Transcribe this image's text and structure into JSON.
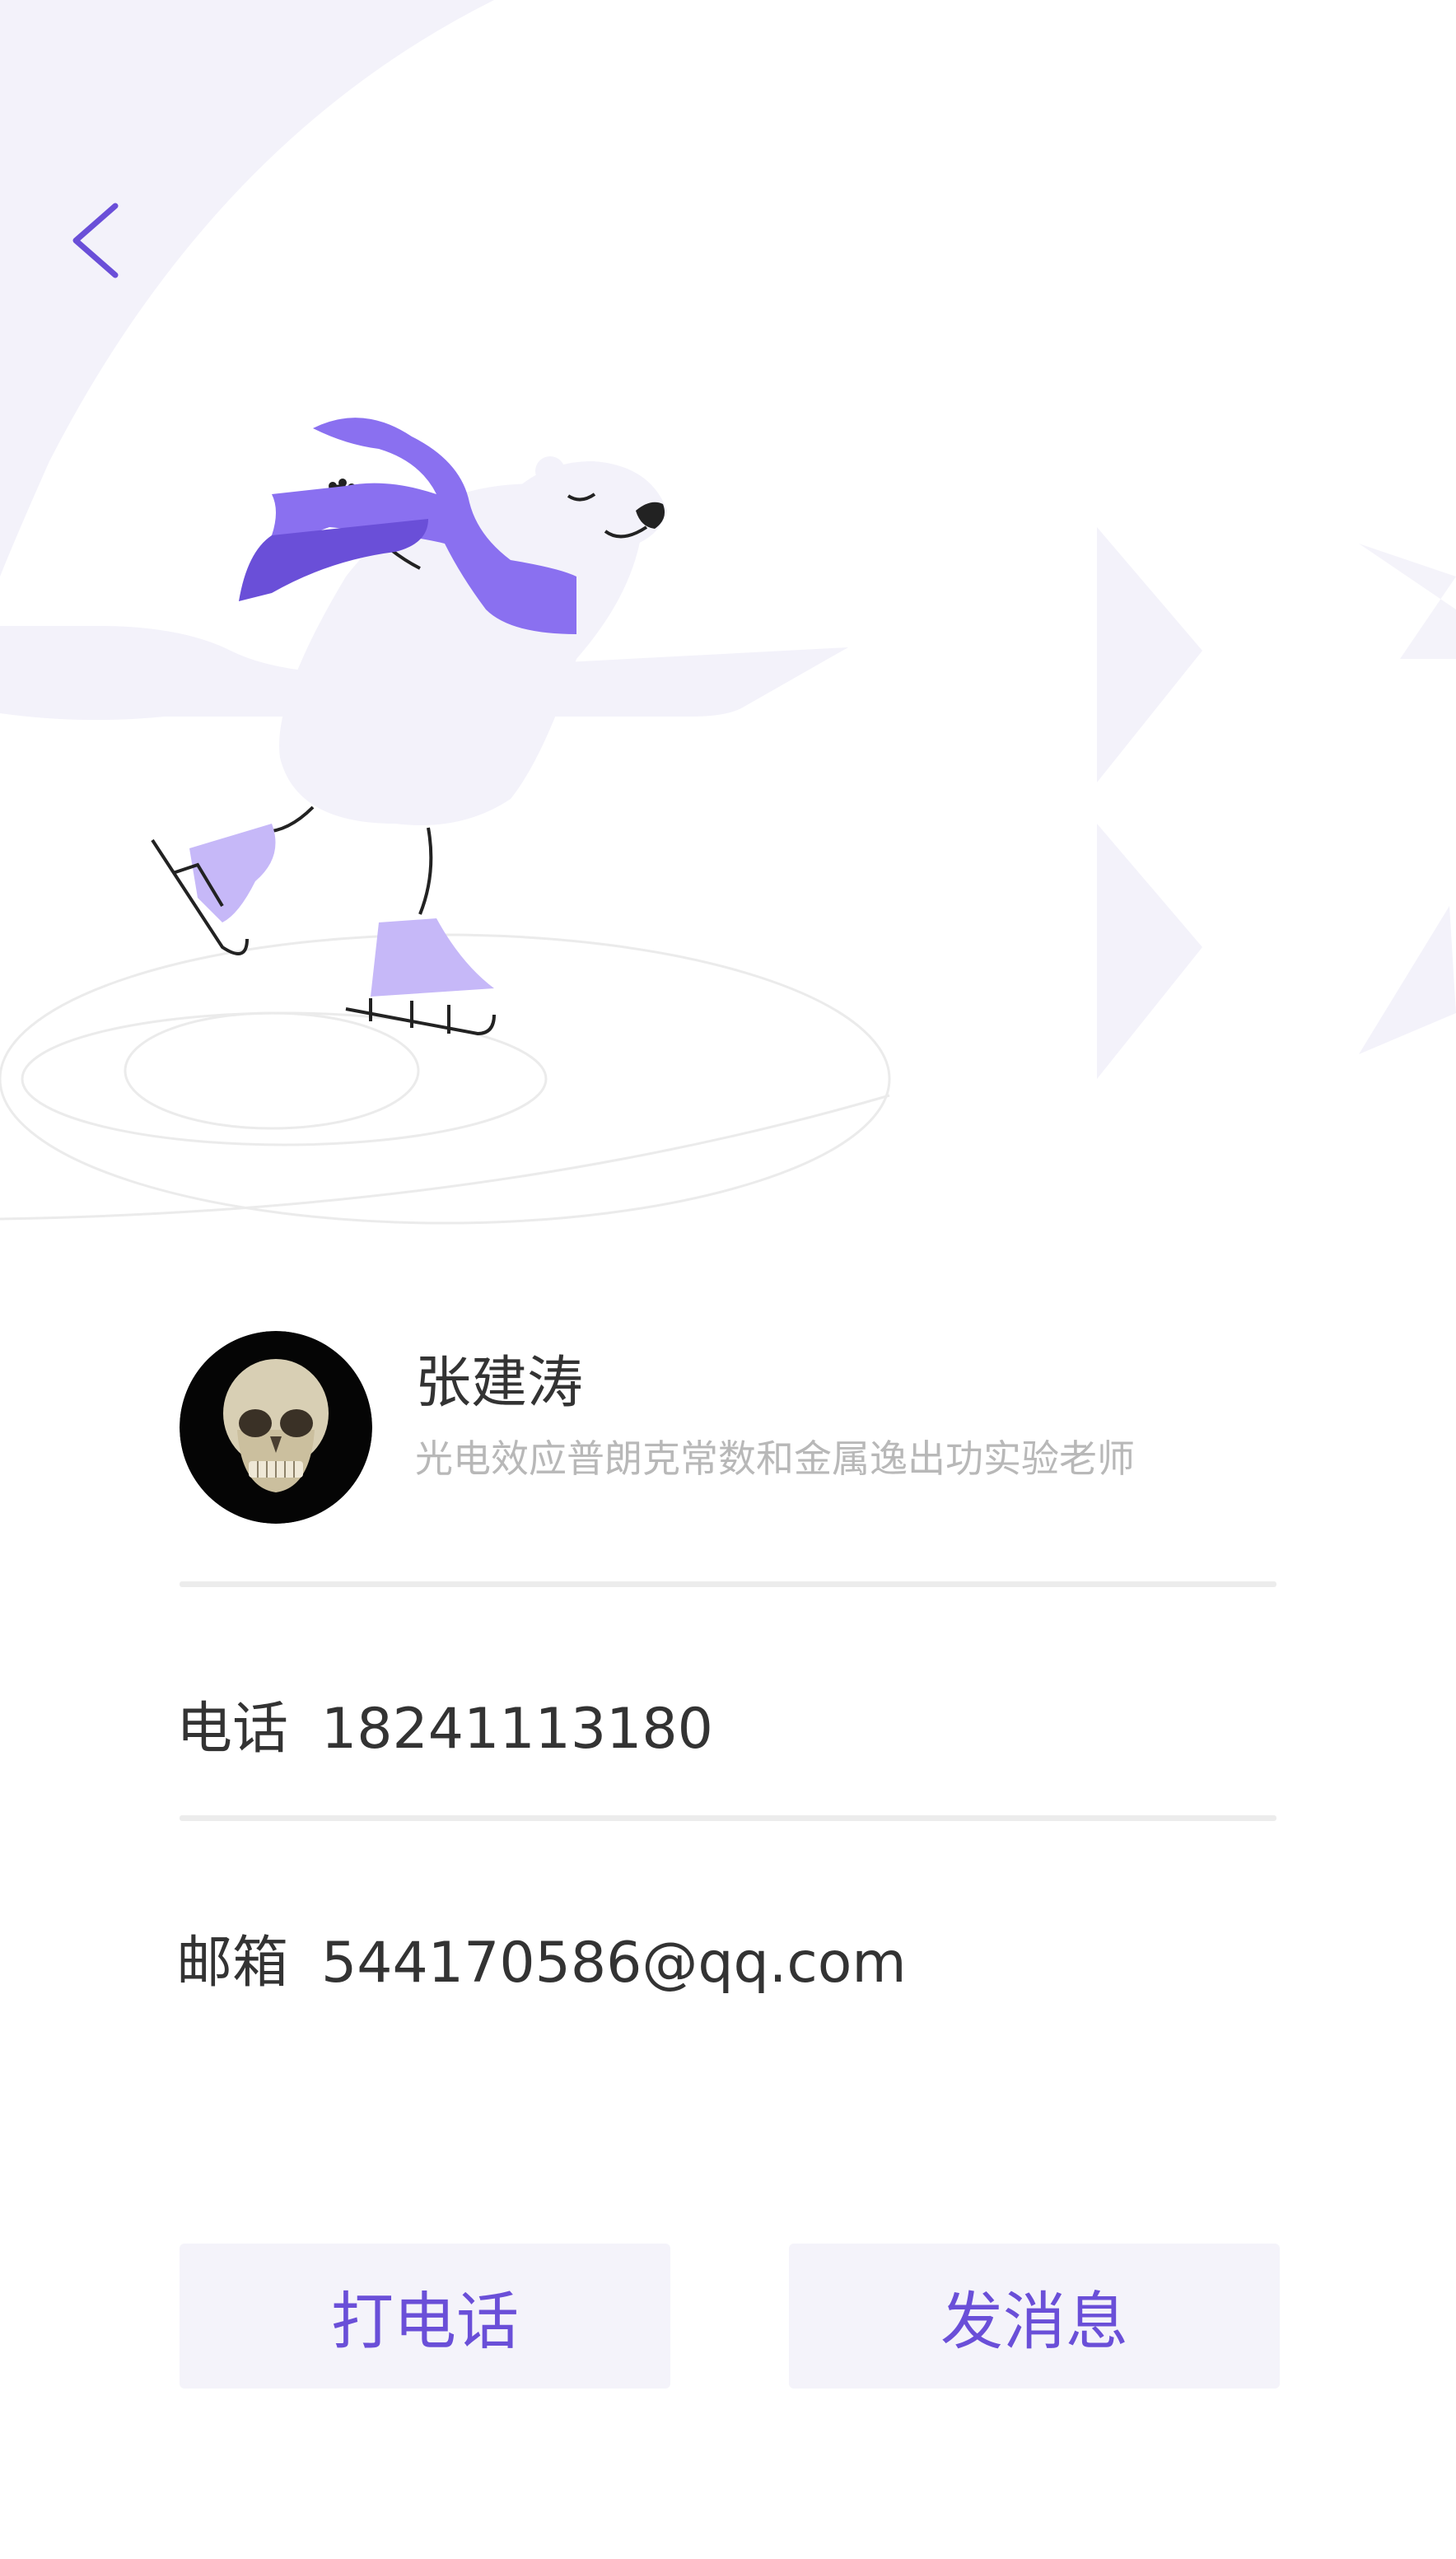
{
  "contact": {
    "name": "张建涛",
    "role": "光电效应普朗克常数和金属逸出功实验老师"
  },
  "phone": {
    "label": "电话",
    "value": "18241113180"
  },
  "email": {
    "label": "邮箱",
    "value": "544170586@qq.com"
  },
  "actions": {
    "call_label": "打电话",
    "message_label": "发消息"
  },
  "colors": {
    "accent": "#6a4fd8",
    "button_bg": "#f4f3fa",
    "decor_bg": "#f3f2fa",
    "muted_text": "#b8b8b8",
    "text": "#333333"
  },
  "icons": {
    "back": "chevron-left-icon",
    "illustration": "skating-polar-bear-illustration",
    "avatar": "skull-avatar"
  }
}
